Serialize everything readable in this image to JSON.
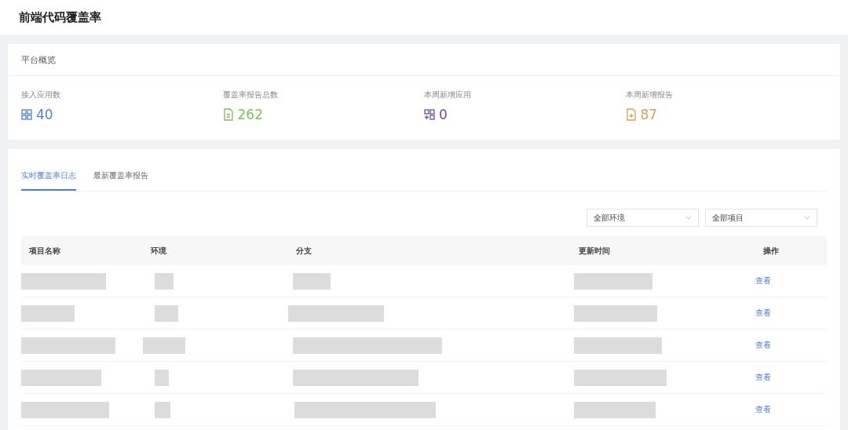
{
  "page_title": "前端代码覆盖率",
  "overview": {
    "title": "平台概览",
    "stats": [
      {
        "label": "接入应用数",
        "value": "40",
        "kind": "apps",
        "color": "#4f7fcf"
      },
      {
        "label": "覆盖率报告总数",
        "value": "262",
        "kind": "report",
        "color": "#7fbf55"
      },
      {
        "label": "本周新增应用",
        "value": "0",
        "kind": "add-app",
        "color": "#6a4fa3"
      },
      {
        "label": "本周新增报告",
        "value": "87",
        "kind": "add-report",
        "color": "#d69f55"
      }
    ]
  },
  "tabs": [
    {
      "label": "实时覆盖率日志",
      "selected": true
    },
    {
      "label": "最新覆盖率报告",
      "selected": false
    }
  ],
  "filters": [
    {
      "value": "全部环境"
    },
    {
      "value": "全部项目"
    }
  ],
  "table": {
    "columns": [
      "项目名称",
      "环境",
      "分支",
      "更新时间",
      "操作"
    ],
    "rows": [
      {
        "action": "查看"
      },
      {
        "action": "查看"
      },
      {
        "action": "查看"
      },
      {
        "action": "查看"
      },
      {
        "action": "查看"
      }
    ]
  }
}
